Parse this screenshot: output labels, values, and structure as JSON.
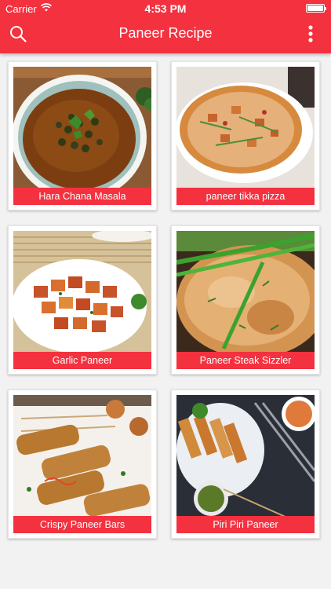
{
  "status_bar": {
    "carrier": "Carrier",
    "time": "4:53 PM",
    "wifi_icon": "wifi-icon",
    "battery_icon": "battery-icon"
  },
  "header": {
    "title": "Paneer Recipe",
    "search_icon": "search-icon",
    "more_icon": "more-vertical-icon",
    "color": "#f4313f"
  },
  "recipes": [
    {
      "name": "Hara Chana Masala"
    },
    {
      "name": "paneer tikka pizza"
    },
    {
      "name": "Garlic Paneer"
    },
    {
      "name": "Paneer Steak Sizzler"
    },
    {
      "name": "Crispy Paneer Bars"
    },
    {
      "name": "Piri Piri Paneer"
    }
  ]
}
